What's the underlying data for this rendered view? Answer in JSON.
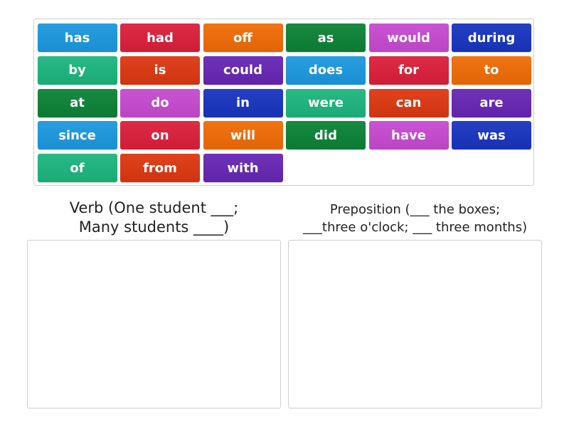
{
  "tile_pool": {
    "tiles": [
      {
        "label": "has",
        "color": "#1b98df"
      },
      {
        "label": "had",
        "color": "#dc1e3a"
      },
      {
        "label": "off",
        "color": "#f06b05"
      },
      {
        "label": "as",
        "color": "#0b8236"
      },
      {
        "label": "would",
        "color": "#c649d0"
      },
      {
        "label": "during",
        "color": "#1834c0"
      },
      {
        "label": "by",
        "color": "#1bb57e"
      },
      {
        "label": "is",
        "color": "#dc3710"
      },
      {
        "label": "could",
        "color": "#6625b4"
      },
      {
        "label": "does",
        "color": "#1b98df"
      },
      {
        "label": "for",
        "color": "#dc1e3a"
      },
      {
        "label": "to",
        "color": "#f06b05"
      },
      {
        "label": "at",
        "color": "#0b8236"
      },
      {
        "label": "do",
        "color": "#c649d0"
      },
      {
        "label": "in",
        "color": "#1834c0"
      },
      {
        "label": "were",
        "color": "#1bb57e"
      },
      {
        "label": "can",
        "color": "#dc3710"
      },
      {
        "label": "are",
        "color": "#6625b4"
      },
      {
        "label": "since",
        "color": "#1b98df"
      },
      {
        "label": "on",
        "color": "#dc1e3a"
      },
      {
        "label": "will",
        "color": "#f06b05"
      },
      {
        "label": "did",
        "color": "#0b8236"
      },
      {
        "label": "have",
        "color": "#c649d0"
      },
      {
        "label": "was",
        "color": "#1834c0"
      },
      {
        "label": "of",
        "color": "#1bb57e"
      },
      {
        "label": "from",
        "color": "#dc3710"
      },
      {
        "label": "with",
        "color": "#6625b4"
      }
    ]
  },
  "groups": {
    "verb": {
      "title_line1": "Verb (One student ___;",
      "title_line2": "Many students ____)"
    },
    "preposition": {
      "title_line1": "Preposition (___ the boxes;",
      "title_line2": "___three o'clock; ___ three months)"
    }
  }
}
